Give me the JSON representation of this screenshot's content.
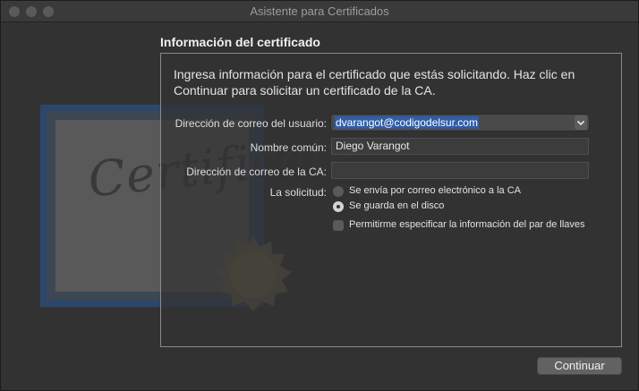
{
  "window": {
    "title": "Asistente para Certificados"
  },
  "heading": "Información del certificado",
  "intro_line1": "Ingresa información para el certificado que estás solicitando. Haz clic en",
  "intro_line2": "Continuar para solicitar un certificado de la CA.",
  "certificate": {
    "script": "Certificate"
  },
  "form": {
    "email_label": "Dirección de correo del usuario:",
    "email_value": "dvarangot@codigodelsur.com",
    "name_label": "Nombre común:",
    "name_value": "Diego Varangot",
    "ca_email_label": "Dirección de correo de la CA:",
    "ca_email_value": "",
    "request_label": "La solicitud:",
    "option_email": "Se envía por correo electrónico a la CA",
    "option_disk": "Se guarda en el disco",
    "option_keypair": "Permitirme especificar la información del par de llaves"
  },
  "buttons": {
    "continue": "Continuar"
  }
}
